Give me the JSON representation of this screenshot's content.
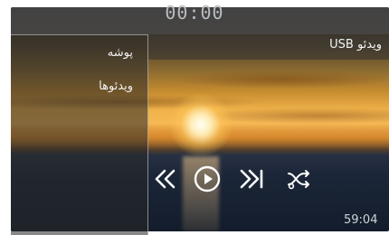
{
  "top_bar": {
    "clock": "00:00"
  },
  "side_panel": {
    "items": [
      {
        "label": "پوشه"
      },
      {
        "label": "ویدئوها"
      }
    ]
  },
  "header": {
    "source": "ویدئو USB"
  },
  "playback": {
    "time": "59:04",
    "controls": [
      "previous-icon",
      "play-icon",
      "next-icon",
      "shuffle-icon"
    ]
  },
  "colors": {
    "controls": "#ffffff",
    "panel_border": "#dcdcdc"
  }
}
